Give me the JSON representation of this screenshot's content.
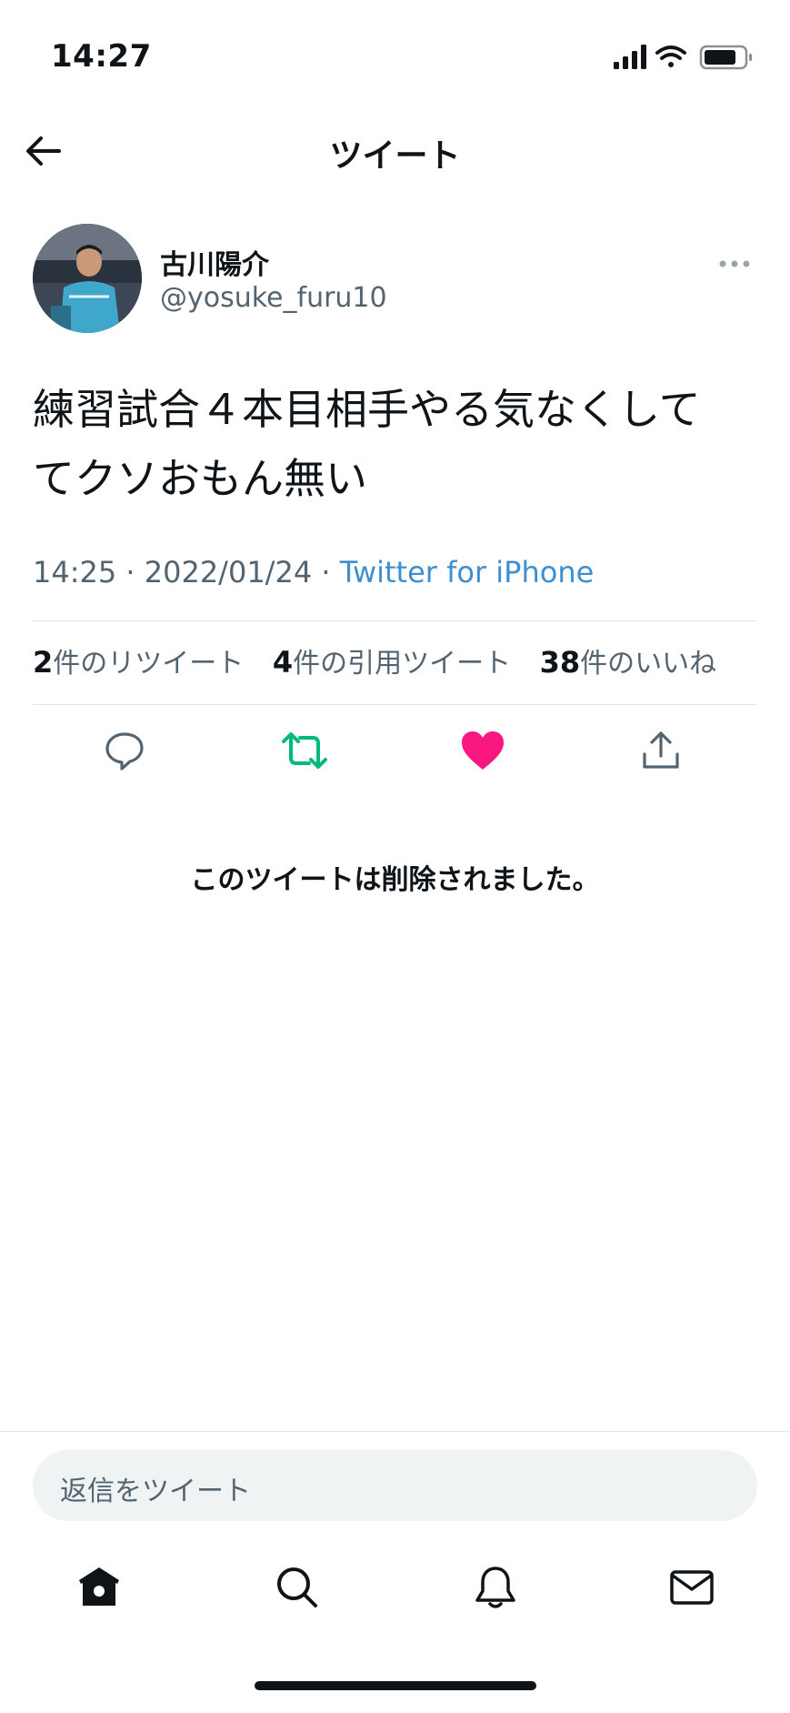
{
  "status_bar": {
    "time": "14:27",
    "icons": [
      "cellular-signal-icon",
      "wifi-icon",
      "battery-icon"
    ]
  },
  "header": {
    "title": "ツイート",
    "back_icon": "back-arrow-icon"
  },
  "tweet": {
    "author_name": "古川陽介",
    "author_handle": "@yosuke_furu10",
    "text_line1": "練習試合４本目相手やる気なくして",
    "text_line2": "てクソおもん無い",
    "time": "14:25",
    "separator": "·",
    "date": "2022/01/24",
    "source": "Twitter for iPhone",
    "stats": {
      "retweets_count": "2",
      "retweets_label": "件のリツイート",
      "quotes_count": "4",
      "quotes_label": "件の引用ツイート",
      "likes_count": "38",
      "likes_label": "件のいいね"
    },
    "actions": [
      "reply-icon",
      "retweet-icon",
      "like-icon",
      "share-icon"
    ]
  },
  "deleted_notice": "このツイートは削除されました。",
  "reply": {
    "placeholder": "返信をツイート"
  },
  "tab_bar": [
    "home-icon",
    "search-icon",
    "notifications-icon",
    "messages-icon"
  ],
  "colors": {
    "text_primary": "#0f1419",
    "text_secondary": "#536471",
    "link": "#3d8fd1",
    "retweet_active": "#00ba7c",
    "like_active": "#f91880",
    "divider": "#e1e6ea",
    "reply_box_bg": "#eff3f4"
  }
}
